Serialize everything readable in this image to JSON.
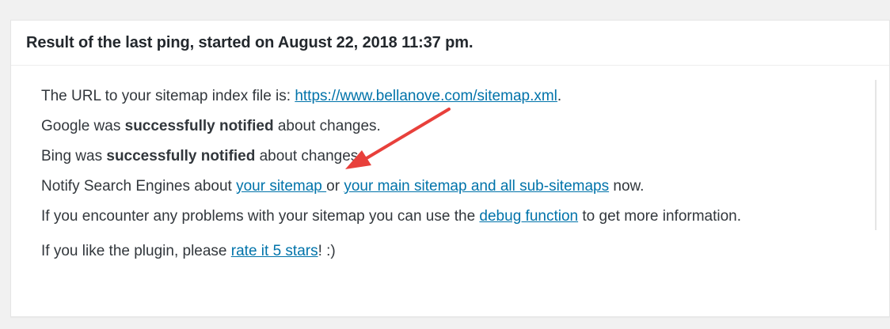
{
  "header": {
    "title": "Result of the last ping, started on August 22, 2018 11:37 pm."
  },
  "body": {
    "sitemap_line": {
      "prefix": "The URL to your sitemap index file is: ",
      "link": "https://www.bellanove.com/sitemap.xml",
      "suffix": "."
    },
    "google_line": {
      "prefix": "Google was ",
      "bold": "successfully notified",
      "suffix": " about changes."
    },
    "bing_line": {
      "prefix": "Bing was ",
      "bold": "successfully notified",
      "suffix": " about changes."
    },
    "notify_line": {
      "prefix": "Notify Search Engines about ",
      "link1": "your sitemap ",
      "middle": "or ",
      "link2": "your main sitemap and all sub-sitemaps",
      "suffix": " now."
    },
    "debug_line": {
      "prefix": "If you encounter any problems with your sitemap you can use the ",
      "link": "debug function",
      "suffix": " to get more information."
    },
    "rate_line": {
      "prefix": "If you like the plugin, please ",
      "link": "rate it 5 stars",
      "suffix": "! :)"
    }
  },
  "colors": {
    "link": "#0073aa",
    "annotation_arrow": "#e8403b"
  }
}
